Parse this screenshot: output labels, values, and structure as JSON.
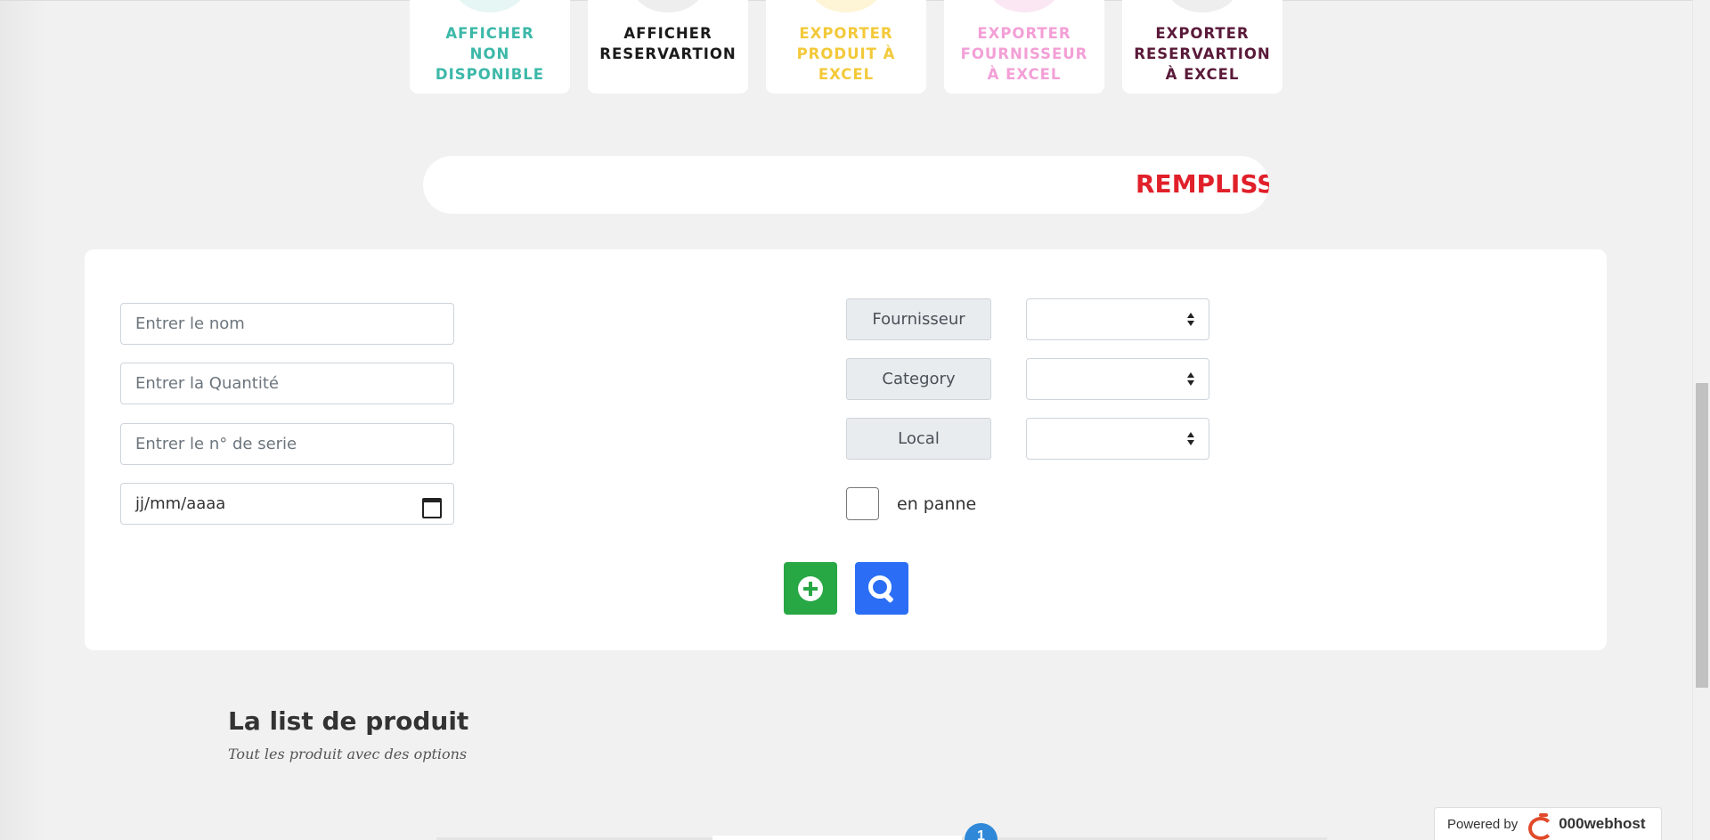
{
  "cards": [
    {
      "label": "AFFICHER NON DISPONIBLE",
      "lines": [
        "AFFICHER",
        "NON",
        "DISPONIBLE"
      ],
      "color": "#3cb8a8",
      "circle": "#e6f6f4"
    },
    {
      "label": "AFFICHER RESERVARTION",
      "lines": [
        "AFFICHER",
        "RESERVARTION"
      ],
      "color": "#1a1a1a",
      "circle": "#eeeeee"
    },
    {
      "label": "EXPORTER PRODUIT À EXCEL",
      "lines": [
        "EXPORTER",
        "PRODUIT À",
        "EXCEL"
      ],
      "color": "#f3c93a",
      "circle": "#fdf5d6"
    },
    {
      "label": "EXPORTER FOURNISSEUR À EXCEL",
      "lines": [
        "EXPORTER",
        "FOURNISSEUR",
        "À EXCEL"
      ],
      "color": "#f39fd6",
      "circle": "#fbe7f3"
    },
    {
      "label": "EXPORTER RESERVARTION À EXCEL",
      "lines": [
        "EXPORTER",
        "RESERVARTION",
        "À EXCEL"
      ],
      "color": "#5a1a3a",
      "circle": "#eeeeee"
    }
  ],
  "marquee": {
    "text": "REMPLISSA",
    "color": "#e0202a"
  },
  "form": {
    "name_placeholder": "Entrer le nom",
    "quantity_placeholder": "Entrer la Quantité",
    "serial_placeholder": "Entrer le n° de serie",
    "date_value": "jj/mm/aaaa",
    "fournisseur_label": "Fournisseur",
    "category_label": "Category",
    "local_label": "Local",
    "fournisseur_value": "",
    "category_value": "",
    "local_value": "",
    "checkbox_label": "en panne",
    "checkbox_checked": false
  },
  "buttons": {
    "add_icon": "plus-circle-icon",
    "search_icon": "search-icon",
    "add_color": "#28a745",
    "search_color": "#2b6ef5"
  },
  "list": {
    "title": "La list de produit",
    "subtitle": "Tout les produit avec des options"
  },
  "pagination": {
    "current_page": "1"
  },
  "footer": {
    "powered_label": "Powered by",
    "brand": "000webhost"
  }
}
